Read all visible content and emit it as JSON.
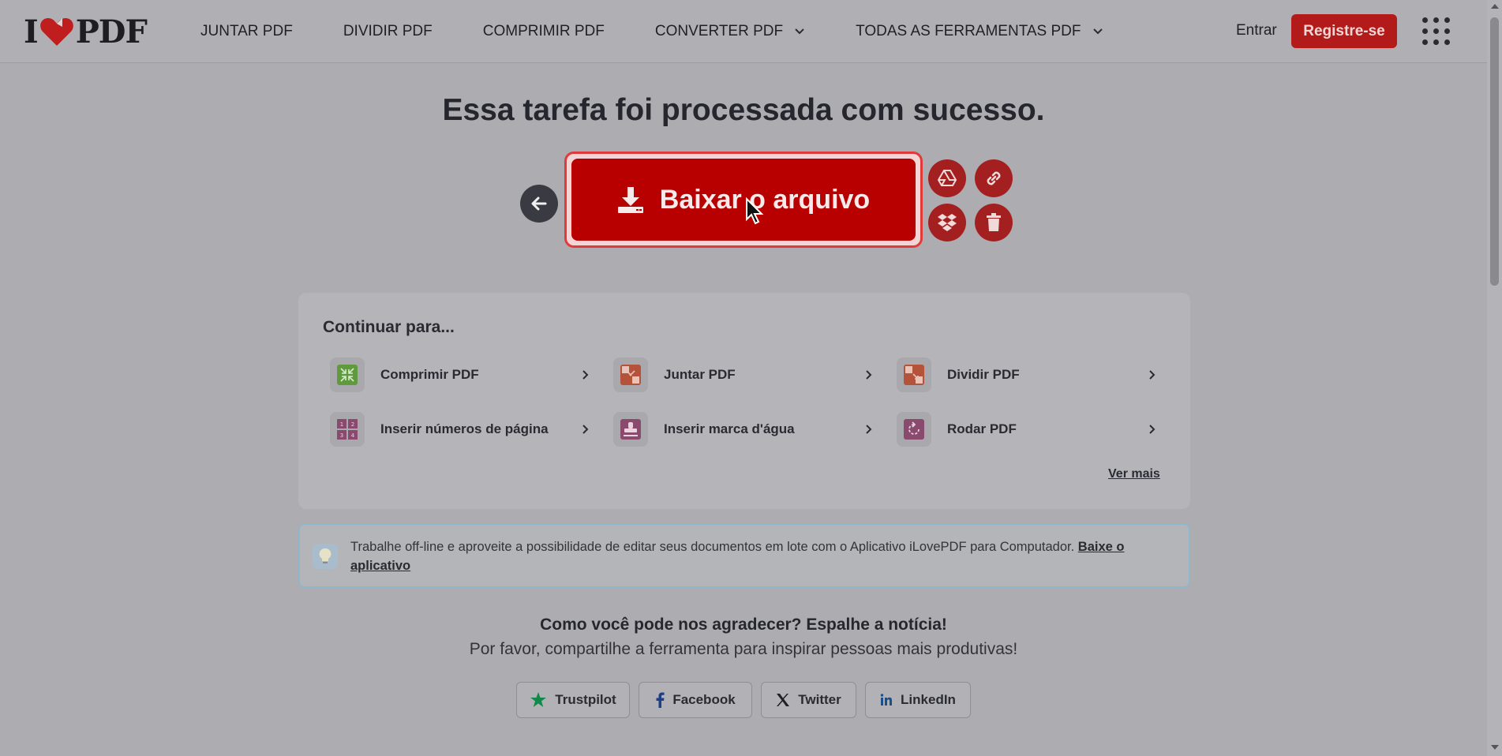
{
  "header": {
    "logo": {
      "left": "I",
      "right": "PDF"
    },
    "nav": [
      {
        "label": "JUNTAR PDF",
        "dropdown": false
      },
      {
        "label": "DIVIDIR PDF",
        "dropdown": false
      },
      {
        "label": "COMPRIMIR PDF",
        "dropdown": false
      },
      {
        "label": "CONVERTER PDF",
        "dropdown": true
      },
      {
        "label": "TODAS AS FERRAMENTAS PDF",
        "dropdown": true
      }
    ],
    "login_label": "Entrar",
    "register_label": "Registre-se"
  },
  "main": {
    "title": "Essa tarefa foi processada com sucesso.",
    "download_label": "Baixar o arquivo",
    "action_icons": [
      "google-drive-icon",
      "link-icon",
      "dropbox-icon",
      "trash-icon"
    ]
  },
  "continue": {
    "title": "Continuar para...",
    "tools": [
      {
        "label": "Comprimir PDF",
        "color": "#5f9a3e"
      },
      {
        "label": "Juntar PDF",
        "color": "#b5523a"
      },
      {
        "label": "Dividir PDF",
        "color": "#b5523a"
      },
      {
        "label": "Inserir números de página",
        "color": "#8a4a6e"
      },
      {
        "label": "Inserir marca d'água",
        "color": "#8a4a6e"
      },
      {
        "label": "Rodar PDF",
        "color": "#8a4a6e"
      }
    ],
    "see_more": "Ver mais"
  },
  "banner": {
    "text": "Trabalhe off-line e aproveite a possibilidade de editar seus documentos em lote com o Aplicativo iLovePDF para Computador.",
    "link_label": "Baixe o aplicativo"
  },
  "share": {
    "title": "Como você pode nos agradecer? Espalhe a notícia!",
    "subtitle": "Por favor, compartilhe a ferramenta para inspirar pessoas mais produtivas!",
    "buttons": [
      {
        "label": "Trustpilot"
      },
      {
        "label": "Facebook"
      },
      {
        "label": "Twitter"
      },
      {
        "label": "LinkedIn"
      }
    ]
  },
  "colors": {
    "brand_red": "#b80000",
    "text": "#26262e"
  }
}
